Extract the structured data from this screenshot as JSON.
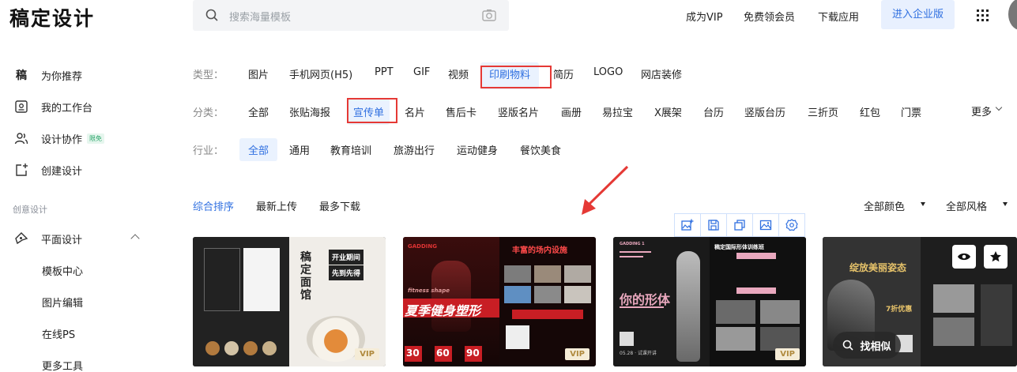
{
  "header": {
    "logo": "稿定设计",
    "search_placeholder": "搜索海量模板",
    "nav": [
      "成为VIP",
      "免费领会员",
      "下载应用"
    ],
    "enterprise": "进入企业版"
  },
  "sidebar": {
    "items": [
      {
        "icon": "gao-logo-icon",
        "glyph": "稿",
        "label": "为你推荐"
      },
      {
        "icon": "workspace-icon",
        "label": "我的工作台"
      },
      {
        "icon": "collaboration-icon",
        "label": "设计协作",
        "badge": "限免"
      },
      {
        "icon": "create-design-icon",
        "label": "创建设计"
      }
    ],
    "group_title": "创意设计",
    "expanded": {
      "icon": "graphic-design-icon",
      "label": "平面设计"
    },
    "sub_items": [
      "模板中心",
      "图片编辑",
      "在线PS",
      "更多工具"
    ]
  },
  "filters": {
    "type": {
      "label": "类型：",
      "options": [
        "图片",
        "手机网页(H5)",
        "PPT",
        "GIF",
        "视频",
        "印刷物料",
        "简历",
        "LOGO",
        "网店装修"
      ],
      "selected": "印刷物料"
    },
    "category": {
      "label": "分类：",
      "options": [
        "全部",
        "张贴海报",
        "宣传单",
        "名片",
        "售后卡",
        "竖版名片",
        "画册",
        "易拉宝",
        "X展架",
        "台历",
        "竖版台历",
        "三折页",
        "红包",
        "门票"
      ],
      "selected": "宣传单",
      "more": "更多"
    },
    "industry": {
      "label": "行业：",
      "options": [
        "全部",
        "通用",
        "教育培训",
        "旅游出行",
        "运动健身",
        "餐饮美食"
      ],
      "selected": "全部"
    }
  },
  "sort": {
    "options": [
      "综合排序",
      "最新上传",
      "最多下载"
    ],
    "active": "综合排序",
    "color_filter": "全部颜色",
    "style_filter": "全部风格"
  },
  "toolbar_icons": [
    "add-image-icon",
    "save-icon",
    "copy-icon",
    "image-icon",
    "settings-icon"
  ],
  "cards": [
    {
      "id": "c1",
      "title_vertical": "稿定面馆",
      "tag": "开业期间",
      "tag2": "先到先得",
      "vip": "VIP"
    },
    {
      "id": "c2",
      "title": "夏季健身塑形",
      "subtitle": "丰富的场内设施",
      "brand": "GADDING",
      "subtitle_en": "fitness shape",
      "numbers": [
        "30",
        "60",
        "90"
      ],
      "vip": "VIP"
    },
    {
      "id": "c3",
      "title": "你的形体",
      "subtitle": "稿定国际形体训练班",
      "brand": "GADDING 1",
      "date": "05.28 · 试课开讲",
      "vip": "VIP"
    },
    {
      "id": "c4",
      "title": "绽放美丽姿态",
      "discount": "7折优惠",
      "similar": "找相似"
    }
  ],
  "colors": {
    "accent": "#2f6fe0",
    "highlight_box": "#e53935",
    "vip_bg": "#f5ecd7"
  }
}
